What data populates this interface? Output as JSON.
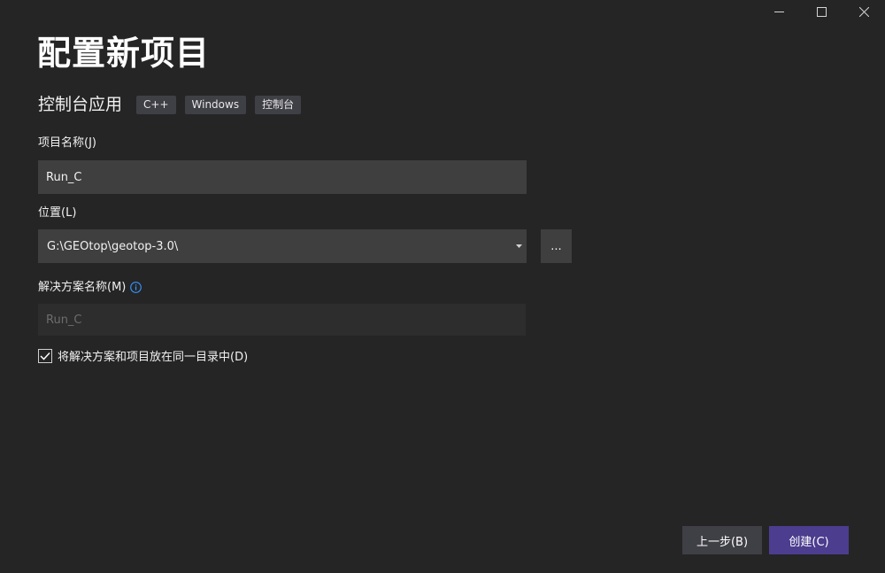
{
  "window_controls": {
    "minimize_icon": "minimize-icon",
    "maximize_icon": "maximize-icon",
    "close_icon": "close-icon"
  },
  "page": {
    "title": "配置新项目"
  },
  "template": {
    "name": "控制台应用",
    "tags": [
      "C++",
      "Windows",
      "控制台"
    ]
  },
  "project_name": {
    "label": "项目名称(J)",
    "value": "Run_C"
  },
  "location": {
    "label": "位置(L)",
    "value": "G:\\GEOtop\\geotop-3.0\\",
    "browse_label": "..."
  },
  "solution_name": {
    "label": "解决方案名称(M)",
    "value": "Run_C",
    "disabled": true
  },
  "same_dir_checkbox": {
    "label": "将解决方案和项目放在同一目录中(D)",
    "checked": true
  },
  "footer": {
    "back_label": "上一步(B)",
    "create_label": "创建(C)"
  },
  "colors": {
    "background": "#252526",
    "input_background": "#3f3f3f",
    "accent": "#4c3d8f",
    "info_icon": "#3794ff"
  }
}
